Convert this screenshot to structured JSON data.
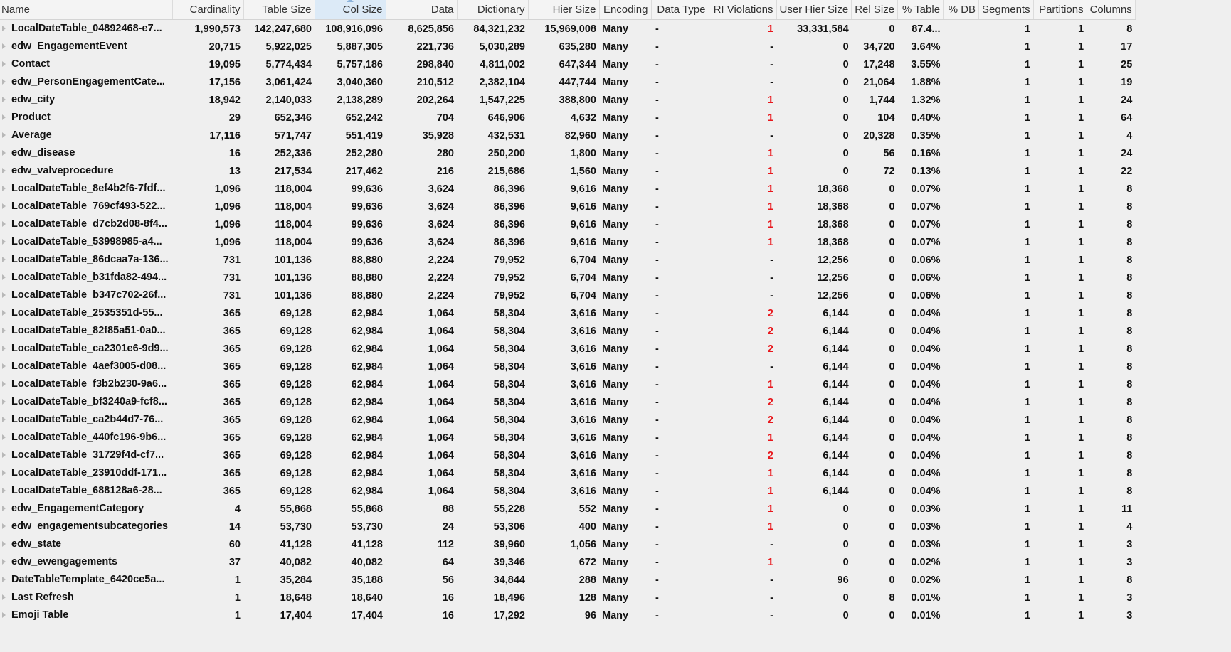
{
  "columns": {
    "name": "Name",
    "cardinality": "Cardinality",
    "table_size": "Table Size",
    "col_size": "Col Size",
    "data": "Data",
    "dictionary": "Dictionary",
    "hier_size": "Hier Size",
    "encoding": "Encoding",
    "data_type": "Data Type",
    "ri_violations": "RI Violations",
    "user_hier_size": "User Hier Size",
    "rel_size": "Rel Size",
    "pct_table": "% Table",
    "pct_db": "% DB",
    "segments": "Segments",
    "partitions": "Partitions",
    "columns": "Columns"
  },
  "sorted_column": "col_size",
  "colors": {
    "background": "#efefef",
    "header_background": "#f4f4f4",
    "sorted_header": "#dceaf7",
    "ri_violation_red": "#e8161b"
  },
  "rows": [
    {
      "name": "LocalDateTable_04892468-e7...",
      "cardinality": "1,990,573",
      "table_size": "142,247,680",
      "col_size": "108,916,096",
      "data": "8,625,856",
      "dictionary": "84,321,232",
      "hier_size": "15,969,008",
      "encoding": "Many",
      "data_type": "-",
      "ri": "1",
      "user_hier_size": "33,331,584",
      "rel_size": "0",
      "pct_table": "87.4...",
      "pct_db": "",
      "segments": "1",
      "partitions": "1",
      "columns": "8"
    },
    {
      "name": "edw_EngagementEvent",
      "cardinality": "20,715",
      "table_size": "5,922,025",
      "col_size": "5,887,305",
      "data": "221,736",
      "dictionary": "5,030,289",
      "hier_size": "635,280",
      "encoding": "Many",
      "data_type": "-",
      "ri": "-",
      "user_hier_size": "0",
      "rel_size": "34,720",
      "pct_table": "3.64%",
      "pct_db": "",
      "segments": "1",
      "partitions": "1",
      "columns": "17"
    },
    {
      "name": "Contact",
      "cardinality": "19,095",
      "table_size": "5,774,434",
      "col_size": "5,757,186",
      "data": "298,840",
      "dictionary": "4,811,002",
      "hier_size": "647,344",
      "encoding": "Many",
      "data_type": "-",
      "ri": "-",
      "user_hier_size": "0",
      "rel_size": "17,248",
      "pct_table": "3.55%",
      "pct_db": "",
      "segments": "1",
      "partitions": "1",
      "columns": "25"
    },
    {
      "name": "edw_PersonEngagementCate...",
      "cardinality": "17,156",
      "table_size": "3,061,424",
      "col_size": "3,040,360",
      "data": "210,512",
      "dictionary": "2,382,104",
      "hier_size": "447,744",
      "encoding": "Many",
      "data_type": "-",
      "ri": "-",
      "user_hier_size": "0",
      "rel_size": "21,064",
      "pct_table": "1.88%",
      "pct_db": "",
      "segments": "1",
      "partitions": "1",
      "columns": "19"
    },
    {
      "name": "edw_city",
      "cardinality": "18,942",
      "table_size": "2,140,033",
      "col_size": "2,138,289",
      "data": "202,264",
      "dictionary": "1,547,225",
      "hier_size": "388,800",
      "encoding": "Many",
      "data_type": "-",
      "ri": "1",
      "user_hier_size": "0",
      "rel_size": "1,744",
      "pct_table": "1.32%",
      "pct_db": "",
      "segments": "1",
      "partitions": "1",
      "columns": "24"
    },
    {
      "name": "Product",
      "cardinality": "29",
      "table_size": "652,346",
      "col_size": "652,242",
      "data": "704",
      "dictionary": "646,906",
      "hier_size": "4,632",
      "encoding": "Many",
      "data_type": "-",
      "ri": "1",
      "user_hier_size": "0",
      "rel_size": "104",
      "pct_table": "0.40%",
      "pct_db": "",
      "segments": "1",
      "partitions": "1",
      "columns": "64"
    },
    {
      "name": "Average",
      "cardinality": "17,116",
      "table_size": "571,747",
      "col_size": "551,419",
      "data": "35,928",
      "dictionary": "432,531",
      "hier_size": "82,960",
      "encoding": "Many",
      "data_type": "-",
      "ri": "-",
      "user_hier_size": "0",
      "rel_size": "20,328",
      "pct_table": "0.35%",
      "pct_db": "",
      "segments": "1",
      "partitions": "1",
      "columns": "4"
    },
    {
      "name": "edw_disease",
      "cardinality": "16",
      "table_size": "252,336",
      "col_size": "252,280",
      "data": "280",
      "dictionary": "250,200",
      "hier_size": "1,800",
      "encoding": "Many",
      "data_type": "-",
      "ri": "1",
      "user_hier_size": "0",
      "rel_size": "56",
      "pct_table": "0.16%",
      "pct_db": "",
      "segments": "1",
      "partitions": "1",
      "columns": "24"
    },
    {
      "name": "edw_valveprocedure",
      "cardinality": "13",
      "table_size": "217,534",
      "col_size": "217,462",
      "data": "216",
      "dictionary": "215,686",
      "hier_size": "1,560",
      "encoding": "Many",
      "data_type": "-",
      "ri": "1",
      "user_hier_size": "0",
      "rel_size": "72",
      "pct_table": "0.13%",
      "pct_db": "",
      "segments": "1",
      "partitions": "1",
      "columns": "22"
    },
    {
      "name": "LocalDateTable_8ef4b2f6-7fdf...",
      "cardinality": "1,096",
      "table_size": "118,004",
      "col_size": "99,636",
      "data": "3,624",
      "dictionary": "86,396",
      "hier_size": "9,616",
      "encoding": "Many",
      "data_type": "-",
      "ri": "1",
      "user_hier_size": "18,368",
      "rel_size": "0",
      "pct_table": "0.07%",
      "pct_db": "",
      "segments": "1",
      "partitions": "1",
      "columns": "8"
    },
    {
      "name": "LocalDateTable_769cf493-522...",
      "cardinality": "1,096",
      "table_size": "118,004",
      "col_size": "99,636",
      "data": "3,624",
      "dictionary": "86,396",
      "hier_size": "9,616",
      "encoding": "Many",
      "data_type": "-",
      "ri": "1",
      "user_hier_size": "18,368",
      "rel_size": "0",
      "pct_table": "0.07%",
      "pct_db": "",
      "segments": "1",
      "partitions": "1",
      "columns": "8"
    },
    {
      "name": "LocalDateTable_d7cb2d08-8f4...",
      "cardinality": "1,096",
      "table_size": "118,004",
      "col_size": "99,636",
      "data": "3,624",
      "dictionary": "86,396",
      "hier_size": "9,616",
      "encoding": "Many",
      "data_type": "-",
      "ri": "1",
      "user_hier_size": "18,368",
      "rel_size": "0",
      "pct_table": "0.07%",
      "pct_db": "",
      "segments": "1",
      "partitions": "1",
      "columns": "8"
    },
    {
      "name": "LocalDateTable_53998985-a4...",
      "cardinality": "1,096",
      "table_size": "118,004",
      "col_size": "99,636",
      "data": "3,624",
      "dictionary": "86,396",
      "hier_size": "9,616",
      "encoding": "Many",
      "data_type": "-",
      "ri": "1",
      "user_hier_size": "18,368",
      "rel_size": "0",
      "pct_table": "0.07%",
      "pct_db": "",
      "segments": "1",
      "partitions": "1",
      "columns": "8"
    },
    {
      "name": "LocalDateTable_86dcaa7a-136...",
      "cardinality": "731",
      "table_size": "101,136",
      "col_size": "88,880",
      "data": "2,224",
      "dictionary": "79,952",
      "hier_size": "6,704",
      "encoding": "Many",
      "data_type": "-",
      "ri": "-",
      "user_hier_size": "12,256",
      "rel_size": "0",
      "pct_table": "0.06%",
      "pct_db": "",
      "segments": "1",
      "partitions": "1",
      "columns": "8"
    },
    {
      "name": "LocalDateTable_b31fda82-494...",
      "cardinality": "731",
      "table_size": "101,136",
      "col_size": "88,880",
      "data": "2,224",
      "dictionary": "79,952",
      "hier_size": "6,704",
      "encoding": "Many",
      "data_type": "-",
      "ri": "-",
      "user_hier_size": "12,256",
      "rel_size": "0",
      "pct_table": "0.06%",
      "pct_db": "",
      "segments": "1",
      "partitions": "1",
      "columns": "8"
    },
    {
      "name": "LocalDateTable_b347c702-26f...",
      "cardinality": "731",
      "table_size": "101,136",
      "col_size": "88,880",
      "data": "2,224",
      "dictionary": "79,952",
      "hier_size": "6,704",
      "encoding": "Many",
      "data_type": "-",
      "ri": "-",
      "user_hier_size": "12,256",
      "rel_size": "0",
      "pct_table": "0.06%",
      "pct_db": "",
      "segments": "1",
      "partitions": "1",
      "columns": "8"
    },
    {
      "name": "LocalDateTable_2535351d-55...",
      "cardinality": "365",
      "table_size": "69,128",
      "col_size": "62,984",
      "data": "1,064",
      "dictionary": "58,304",
      "hier_size": "3,616",
      "encoding": "Many",
      "data_type": "-",
      "ri": "2",
      "user_hier_size": "6,144",
      "rel_size": "0",
      "pct_table": "0.04%",
      "pct_db": "",
      "segments": "1",
      "partitions": "1",
      "columns": "8"
    },
    {
      "name": "LocalDateTable_82f85a51-0a0...",
      "cardinality": "365",
      "table_size": "69,128",
      "col_size": "62,984",
      "data": "1,064",
      "dictionary": "58,304",
      "hier_size": "3,616",
      "encoding": "Many",
      "data_type": "-",
      "ri": "2",
      "user_hier_size": "6,144",
      "rel_size": "0",
      "pct_table": "0.04%",
      "pct_db": "",
      "segments": "1",
      "partitions": "1",
      "columns": "8"
    },
    {
      "name": "LocalDateTable_ca2301e6-9d9...",
      "cardinality": "365",
      "table_size": "69,128",
      "col_size": "62,984",
      "data": "1,064",
      "dictionary": "58,304",
      "hier_size": "3,616",
      "encoding": "Many",
      "data_type": "-",
      "ri": "2",
      "user_hier_size": "6,144",
      "rel_size": "0",
      "pct_table": "0.04%",
      "pct_db": "",
      "segments": "1",
      "partitions": "1",
      "columns": "8"
    },
    {
      "name": "LocalDateTable_4aef3005-d08...",
      "cardinality": "365",
      "table_size": "69,128",
      "col_size": "62,984",
      "data": "1,064",
      "dictionary": "58,304",
      "hier_size": "3,616",
      "encoding": "Many",
      "data_type": "-",
      "ri": "-",
      "user_hier_size": "6,144",
      "rel_size": "0",
      "pct_table": "0.04%",
      "pct_db": "",
      "segments": "1",
      "partitions": "1",
      "columns": "8"
    },
    {
      "name": "LocalDateTable_f3b2b230-9a6...",
      "cardinality": "365",
      "table_size": "69,128",
      "col_size": "62,984",
      "data": "1,064",
      "dictionary": "58,304",
      "hier_size": "3,616",
      "encoding": "Many",
      "data_type": "-",
      "ri": "1",
      "user_hier_size": "6,144",
      "rel_size": "0",
      "pct_table": "0.04%",
      "pct_db": "",
      "segments": "1",
      "partitions": "1",
      "columns": "8"
    },
    {
      "name": "LocalDateTable_bf3240a9-fcf8...",
      "cardinality": "365",
      "table_size": "69,128",
      "col_size": "62,984",
      "data": "1,064",
      "dictionary": "58,304",
      "hier_size": "3,616",
      "encoding": "Many",
      "data_type": "-",
      "ri": "2",
      "user_hier_size": "6,144",
      "rel_size": "0",
      "pct_table": "0.04%",
      "pct_db": "",
      "segments": "1",
      "partitions": "1",
      "columns": "8"
    },
    {
      "name": "LocalDateTable_ca2b44d7-76...",
      "cardinality": "365",
      "table_size": "69,128",
      "col_size": "62,984",
      "data": "1,064",
      "dictionary": "58,304",
      "hier_size": "3,616",
      "encoding": "Many",
      "data_type": "-",
      "ri": "2",
      "user_hier_size": "6,144",
      "rel_size": "0",
      "pct_table": "0.04%",
      "pct_db": "",
      "segments": "1",
      "partitions": "1",
      "columns": "8"
    },
    {
      "name": "LocalDateTable_440fc196-9b6...",
      "cardinality": "365",
      "table_size": "69,128",
      "col_size": "62,984",
      "data": "1,064",
      "dictionary": "58,304",
      "hier_size": "3,616",
      "encoding": "Many",
      "data_type": "-",
      "ri": "1",
      "user_hier_size": "6,144",
      "rel_size": "0",
      "pct_table": "0.04%",
      "pct_db": "",
      "segments": "1",
      "partitions": "1",
      "columns": "8"
    },
    {
      "name": "LocalDateTable_31729f4d-cf7...",
      "cardinality": "365",
      "table_size": "69,128",
      "col_size": "62,984",
      "data": "1,064",
      "dictionary": "58,304",
      "hier_size": "3,616",
      "encoding": "Many",
      "data_type": "-",
      "ri": "2",
      "user_hier_size": "6,144",
      "rel_size": "0",
      "pct_table": "0.04%",
      "pct_db": "",
      "segments": "1",
      "partitions": "1",
      "columns": "8"
    },
    {
      "name": "LocalDateTable_23910ddf-171...",
      "cardinality": "365",
      "table_size": "69,128",
      "col_size": "62,984",
      "data": "1,064",
      "dictionary": "58,304",
      "hier_size": "3,616",
      "encoding": "Many",
      "data_type": "-",
      "ri": "1",
      "user_hier_size": "6,144",
      "rel_size": "0",
      "pct_table": "0.04%",
      "pct_db": "",
      "segments": "1",
      "partitions": "1",
      "columns": "8"
    },
    {
      "name": "LocalDateTable_688128a6-28...",
      "cardinality": "365",
      "table_size": "69,128",
      "col_size": "62,984",
      "data": "1,064",
      "dictionary": "58,304",
      "hier_size": "3,616",
      "encoding": "Many",
      "data_type": "-",
      "ri": "1",
      "user_hier_size": "6,144",
      "rel_size": "0",
      "pct_table": "0.04%",
      "pct_db": "",
      "segments": "1",
      "partitions": "1",
      "columns": "8"
    },
    {
      "name": "edw_EngagementCategory",
      "cardinality": "4",
      "table_size": "55,868",
      "col_size": "55,868",
      "data": "88",
      "dictionary": "55,228",
      "hier_size": "552",
      "encoding": "Many",
      "data_type": "-",
      "ri": "1",
      "user_hier_size": "0",
      "rel_size": "0",
      "pct_table": "0.03%",
      "pct_db": "",
      "segments": "1",
      "partitions": "1",
      "columns": "11"
    },
    {
      "name": "edw_engagementsubcategories",
      "cardinality": "14",
      "table_size": "53,730",
      "col_size": "53,730",
      "data": "24",
      "dictionary": "53,306",
      "hier_size": "400",
      "encoding": "Many",
      "data_type": "-",
      "ri": "1",
      "user_hier_size": "0",
      "rel_size": "0",
      "pct_table": "0.03%",
      "pct_db": "",
      "segments": "1",
      "partitions": "1",
      "columns": "4"
    },
    {
      "name": "edw_state",
      "cardinality": "60",
      "table_size": "41,128",
      "col_size": "41,128",
      "data": "112",
      "dictionary": "39,960",
      "hier_size": "1,056",
      "encoding": "Many",
      "data_type": "-",
      "ri": "-",
      "user_hier_size": "0",
      "rel_size": "0",
      "pct_table": "0.03%",
      "pct_db": "",
      "segments": "1",
      "partitions": "1",
      "columns": "3"
    },
    {
      "name": "edw_ewengagements",
      "cardinality": "37",
      "table_size": "40,082",
      "col_size": "40,082",
      "data": "64",
      "dictionary": "39,346",
      "hier_size": "672",
      "encoding": "Many",
      "data_type": "-",
      "ri": "1",
      "user_hier_size": "0",
      "rel_size": "0",
      "pct_table": "0.02%",
      "pct_db": "",
      "segments": "1",
      "partitions": "1",
      "columns": "3"
    },
    {
      "name": "DateTableTemplate_6420ce5a...",
      "cardinality": "1",
      "table_size": "35,284",
      "col_size": "35,188",
      "data": "56",
      "dictionary": "34,844",
      "hier_size": "288",
      "encoding": "Many",
      "data_type": "-",
      "ri": "-",
      "user_hier_size": "96",
      "rel_size": "0",
      "pct_table": "0.02%",
      "pct_db": "",
      "segments": "1",
      "partitions": "1",
      "columns": "8"
    },
    {
      "name": "Last Refresh",
      "cardinality": "1",
      "table_size": "18,648",
      "col_size": "18,640",
      "data": "16",
      "dictionary": "18,496",
      "hier_size": "128",
      "encoding": "Many",
      "data_type": "-",
      "ri": "-",
      "user_hier_size": "0",
      "rel_size": "8",
      "pct_table": "0.01%",
      "pct_db": "",
      "segments": "1",
      "partitions": "1",
      "columns": "3"
    },
    {
      "name": "Emoji Table",
      "cardinality": "1",
      "table_size": "17,404",
      "col_size": "17,404",
      "data": "16",
      "dictionary": "17,292",
      "hier_size": "96",
      "encoding": "Many",
      "data_type": "-",
      "ri": "-",
      "user_hier_size": "0",
      "rel_size": "0",
      "pct_table": "0.01%",
      "pct_db": "",
      "segments": "1",
      "partitions": "1",
      "columns": "3"
    }
  ]
}
